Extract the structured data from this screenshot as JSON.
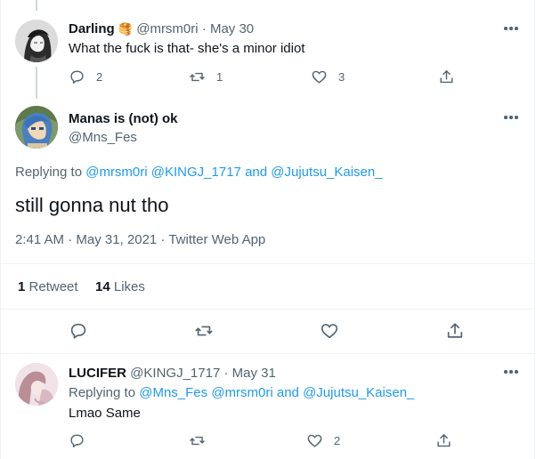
{
  "tweet1": {
    "name": "Darling",
    "emoji": "🥞",
    "handle": "@mrsm0ri",
    "sep": "·",
    "date": "May 30",
    "text": "What the fuck is that- she's a minor idiot",
    "replies": "2",
    "retweets": "1",
    "likes": "3"
  },
  "main": {
    "name": "Manas is (not) ok",
    "handle": "@Mns_Fes",
    "replying_prefix": "Replying to",
    "mention1": "@mrsm0ri",
    "mention2": "@KINGJ_1717",
    "and": "and",
    "mention3": "@Jujutsu_Kaisen_",
    "text": "still gonna nut tho",
    "timestamp": "2:41 AM · May 31, 2021 · Twitter Web App",
    "retweet_count": "1",
    "retweet_label": "Retweet",
    "like_count": "14",
    "like_label": "Likes"
  },
  "tweet3": {
    "name": "LUCIFER",
    "handle": "@KINGJ_1717",
    "sep": "·",
    "date": "May 31",
    "replying_prefix": "Replying to",
    "mention1": "@Mns_Fes",
    "mention2": "@mrsm0ri",
    "and": "and",
    "mention3": "@Jujutsu_Kaisen_",
    "text": "Lmao Same",
    "likes": "2"
  },
  "colors": {
    "accent": "#1d9bf0",
    "muted": "#536471",
    "border": "#eff3f4"
  },
  "icons": [
    "reply-icon",
    "retweet-icon",
    "like-icon",
    "share-icon",
    "more-icon"
  ]
}
